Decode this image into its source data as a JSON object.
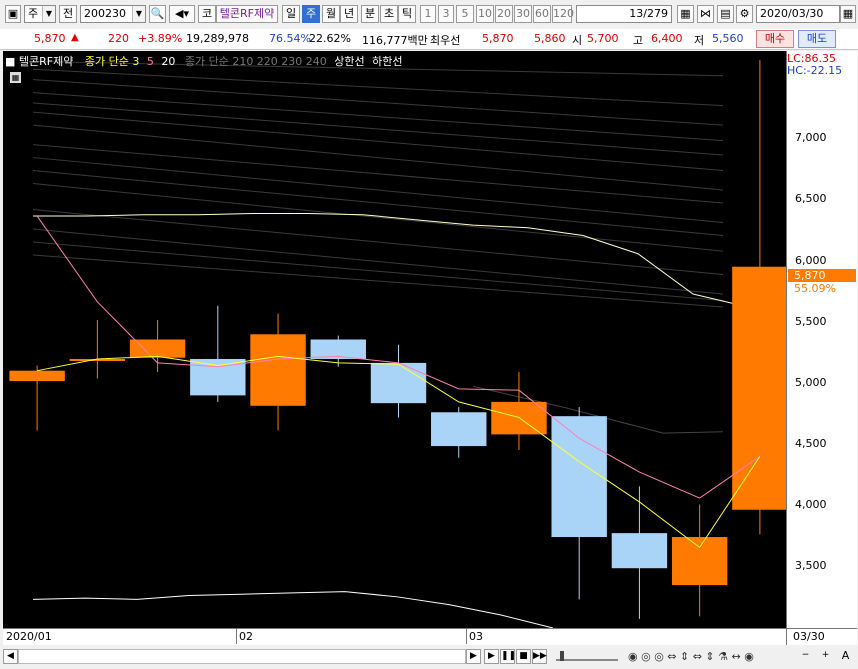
{
  "toolbar": {
    "period_label": "주",
    "all_label": "전",
    "code": "200230",
    "code_label": "코",
    "name": "텔콘RF제약",
    "periods": [
      "일",
      "주",
      "월",
      "년",
      "분",
      "초",
      "틱"
    ],
    "counts": [
      "1",
      "3",
      "5",
      "10",
      "20",
      "30",
      "60",
      "120"
    ],
    "page_counter": "13/279",
    "date": "2020/03/30"
  },
  "info": {
    "price": "5,870",
    "change": "220",
    "change_pct": "+3.89%",
    "volume": "19,289,978",
    "vol_ratio": "76.54%",
    "turnover": "22.62%",
    "amount": "116,777백만",
    "best_label": "최우선",
    "ask": "5,870",
    "bid": "5,860",
    "open_label": "시",
    "open": "5,700",
    "high_label": "고",
    "high": "6,400",
    "low_label": "저",
    "low": "5,560",
    "buy_label": "매수",
    "sell_label": "매도"
  },
  "legend": {
    "name": "텔콘RF제약",
    "ma_label": "종가 단순 3",
    "ma5": "5",
    "ma20": "20",
    "extra": "종가 단순 210  220  230  240",
    "upper": "상한선",
    "lower": "하한선"
  },
  "axis": {
    "lc": "LC:86.35",
    "hc": "HC:-22.15",
    "price_label": "5,870",
    "pct_label": "55.09%",
    "ticks": [
      "7,000",
      "6,500",
      "6,000",
      "5,500",
      "5,000",
      "4,500",
      "4,000",
      "3,500"
    ]
  },
  "xaxis": {
    "labels": [
      "2020/01",
      "02",
      "03"
    ],
    "end": "03/30"
  },
  "colors": {
    "up": "#ff7a00",
    "down": "#a9d4f7",
    "ma3": "#ffff33",
    "ma5": "#ff7fb0",
    "band": "#ffffff"
  },
  "chart_data": {
    "type": "candlestick",
    "ylim": [
      3080,
      7520
    ],
    "candles": [
      {
        "o": 4980,
        "c": 5060,
        "h": 5100,
        "l": 4600
      },
      {
        "o": 5150,
        "c": 5150,
        "h": 5450,
        "l": 5000
      },
      {
        "o": 5160,
        "c": 5300,
        "h": 5450,
        "l": 5050
      },
      {
        "o": 5150,
        "c": 4870,
        "h": 5560,
        "l": 4820
      },
      {
        "o": 4790,
        "c": 5340,
        "h": 5500,
        "l": 4600
      },
      {
        "o": 5300,
        "c": 5150,
        "h": 5330,
        "l": 5090
      },
      {
        "o": 5120,
        "c": 4810,
        "h": 5260,
        "l": 4700
      },
      {
        "o": 4740,
        "c": 4480,
        "h": 4780,
        "l": 4390
      },
      {
        "o": 4570,
        "c": 4820,
        "h": 5050,
        "l": 4450
      },
      {
        "o": 4710,
        "c": 3780,
        "h": 4780,
        "l": 3300
      },
      {
        "o": 3810,
        "c": 3540,
        "h": 4170,
        "l": 3150
      },
      {
        "o": 3410,
        "c": 3780,
        "h": 4030,
        "l": 3170
      },
      {
        "o": 3990,
        "c": 5860,
        "h": 7450,
        "l": 3800
      }
    ],
    "ma3": [
      5060,
      5150,
      5170,
      5100,
      5170,
      5120,
      5110,
      4820,
      4700,
      4360,
      4050,
      3700,
      4400
    ],
    "ma5": [
      6250,
      5590,
      5120,
      5090,
      5150,
      5170,
      5120,
      4920,
      4910,
      4540,
      4280,
      4080,
      4400
    ]
  }
}
